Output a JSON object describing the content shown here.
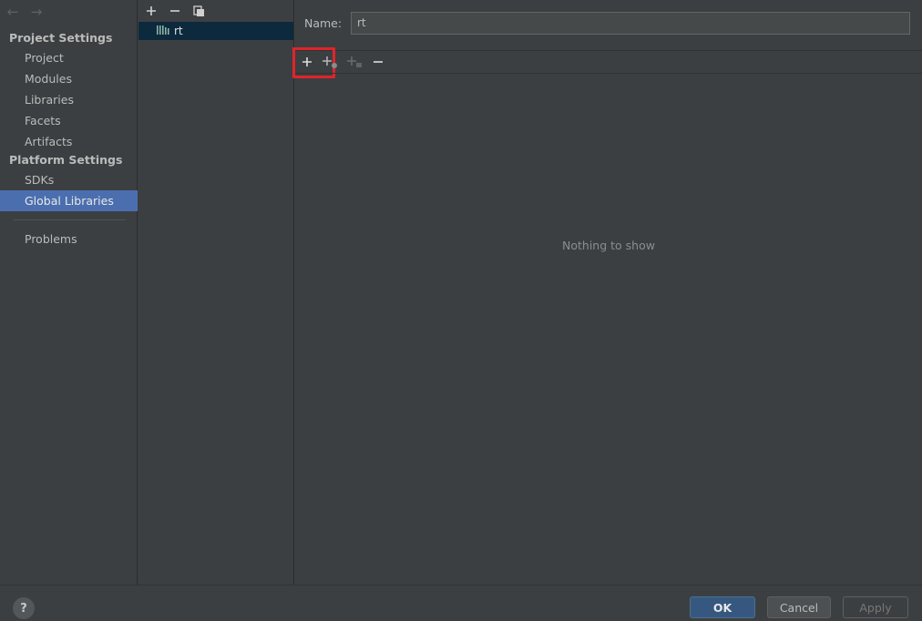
{
  "sidebar": {
    "back_arrow": "←",
    "forward_arrow": "→",
    "project_settings_header": "Project Settings",
    "project_items": [
      "Project",
      "Modules",
      "Libraries",
      "Facets",
      "Artifacts"
    ],
    "platform_settings_header": "Platform Settings",
    "platform_items": [
      "SDKs",
      "Global Libraries"
    ],
    "selected_item": "Global Libraries",
    "problems_item": "Problems"
  },
  "library_list": {
    "toolbar_icons": [
      "add-icon",
      "remove-icon",
      "copy-icon"
    ],
    "items": [
      {
        "name": "rt",
        "icon": "library-icon",
        "selected": true
      }
    ]
  },
  "details": {
    "name_label": "Name:",
    "name_value": "rt",
    "roots_toolbar_icons": [
      "add-icon",
      "add-classes-icon",
      "add-sources-icon",
      "remove-icon"
    ],
    "empty_text": "Nothing to show",
    "highlight_color": "#e0242b"
  },
  "footer": {
    "help_label": "?",
    "ok_label": "OK",
    "cancel_label": "Cancel",
    "apply_label": "Apply"
  },
  "colors": {
    "background": "#3c3f41",
    "selection": "#4b6eaf",
    "list_selection": "#0d293e",
    "primary_button": "#365880"
  }
}
